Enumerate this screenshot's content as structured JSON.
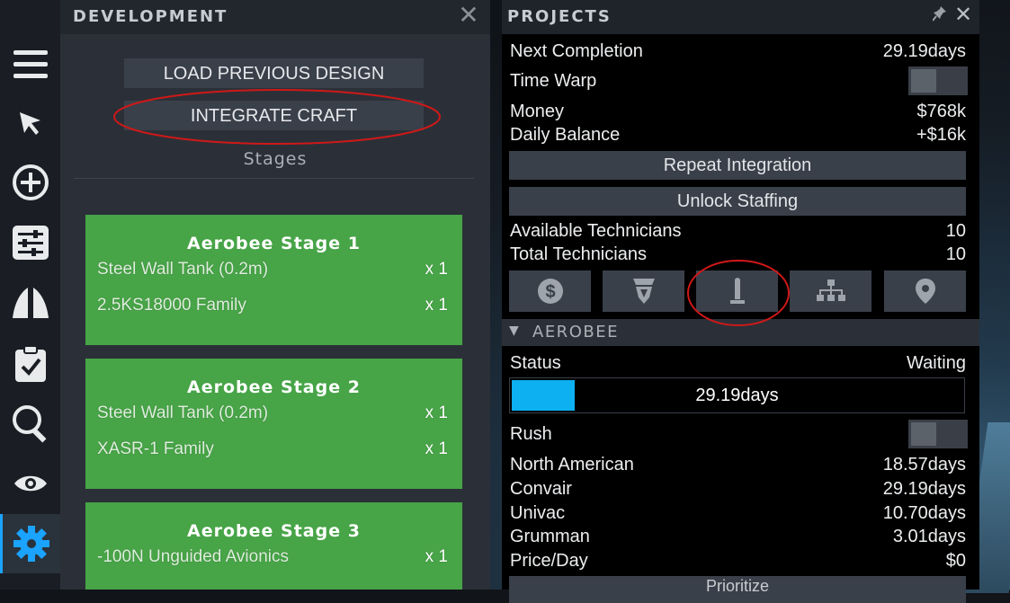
{
  "rail": {
    "icons": [
      "menu-icon",
      "cursor-icon",
      "add-circle-icon",
      "sliders-icon",
      "rocket-split-icon",
      "clipboard-check-icon",
      "search-icon",
      "eye-icon",
      "settings-gear-icon"
    ]
  },
  "development": {
    "title": "DEVELOPMENT",
    "close_glyph": "✕",
    "load_button": "LOAD PREVIOUS DESIGN",
    "integrate_button": "INTEGRATE CRAFT",
    "stages_label": "Stages",
    "stages": [
      {
        "title": "Aerobee Stage 1",
        "parts": [
          {
            "name": "Steel Wall Tank (0.2m)",
            "qty": "x 1"
          },
          {
            "name": "2.5KS18000 Family",
            "qty": "x 1"
          }
        ]
      },
      {
        "title": "Aerobee Stage 2",
        "parts": [
          {
            "name": "Steel Wall Tank (0.2m)",
            "qty": "x 1"
          },
          {
            "name": "XASR-1 Family",
            "qty": "x 1"
          }
        ]
      },
      {
        "title": "Aerobee Stage 3",
        "parts": [
          {
            "name": "-100N Unguided Avionics",
            "qty": "x 1"
          }
        ]
      }
    ]
  },
  "projects": {
    "title": "PROJECTS",
    "pin_glyph": "📌",
    "close_glyph": "✕",
    "next_completion_label": "Next Completion",
    "next_completion_value": "29.19days",
    "time_warp_label": "Time Warp",
    "time_warp_on": false,
    "money_label": "Money",
    "money_value": "$768k",
    "daily_balance_label": "Daily Balance",
    "daily_balance_value": "+$16k",
    "repeat_integration": "Repeat Integration",
    "unlock_staffing": "Unlock Staffing",
    "available_technicians_label": "Available Technicians",
    "available_technicians_value": "10",
    "total_technicians_label": "Total Technicians",
    "total_technicians_value": "10",
    "tab_icons": [
      "dollar-coin-icon",
      "rocket-engine-icon",
      "rocket-icon",
      "org-chart-icon",
      "location-pin-icon"
    ],
    "section_title": "AEROBEE",
    "section_arrow": "▼",
    "status_label": "Status",
    "status_value": "Waiting",
    "progress_text": "29.19days",
    "progress_fraction": 0.14,
    "rush_label": "Rush",
    "rush_on": false,
    "contractors": [
      {
        "name": "North American",
        "value": "18.57days"
      },
      {
        "name": "Convair",
        "value": "29.19days"
      },
      {
        "name": "Univac",
        "value": "10.70days"
      },
      {
        "name": "Grumman",
        "value": "3.01days"
      },
      {
        "name": "Price/Day",
        "value": "$0"
      }
    ],
    "prioritize_button": "Prioritize"
  },
  "colors": {
    "accent": "#1aa3ff",
    "stage_green": "#47a447",
    "progress_blue": "#0db0f0",
    "annotation_red": "#d01818"
  }
}
